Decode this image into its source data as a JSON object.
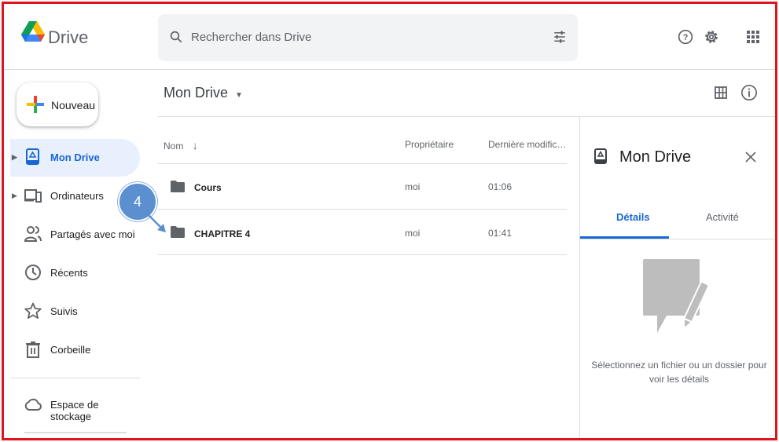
{
  "app": {
    "name": "Drive"
  },
  "search": {
    "placeholder": "Rechercher dans Drive"
  },
  "header": {
    "icons": [
      "help-icon",
      "settings-icon",
      "apps-grid-icon"
    ]
  },
  "sidebar": {
    "new_label": "Nouveau",
    "items": [
      {
        "label": "Mon Drive",
        "icon": "drive-icon",
        "active": true,
        "expandable": true
      },
      {
        "label": "Ordinateurs",
        "icon": "computers-icon",
        "expandable": true
      },
      {
        "label": "Partagés avec moi",
        "icon": "shared-icon"
      },
      {
        "label": "Récents",
        "icon": "clock-icon"
      },
      {
        "label": "Suivis",
        "icon": "star-icon"
      },
      {
        "label": "Corbeille",
        "icon": "trash-icon"
      }
    ],
    "storage_label": "Espace de stockage"
  },
  "main": {
    "title": "Mon Drive",
    "columns": {
      "name": "Nom",
      "owner": "Propriétaire",
      "modified": "Dernière modific…"
    },
    "files": [
      {
        "name": "Cours",
        "owner": "moi",
        "modified": "01:06"
      },
      {
        "name": "CHAPITRE 4",
        "owner": "moi",
        "modified": "01:41"
      }
    ]
  },
  "details_panel": {
    "title": "Mon Drive",
    "tabs": [
      "Détails",
      "Activité"
    ],
    "active_tab": "Détails",
    "message": "Sélectionnez un fichier ou un dossier pour voir les détails"
  },
  "annotation": {
    "number": "4"
  },
  "colors": {
    "accent": "#1967d2",
    "active_bg": "#e8f0fe",
    "border": "#e0141c",
    "callout": "#5b8fd0"
  }
}
